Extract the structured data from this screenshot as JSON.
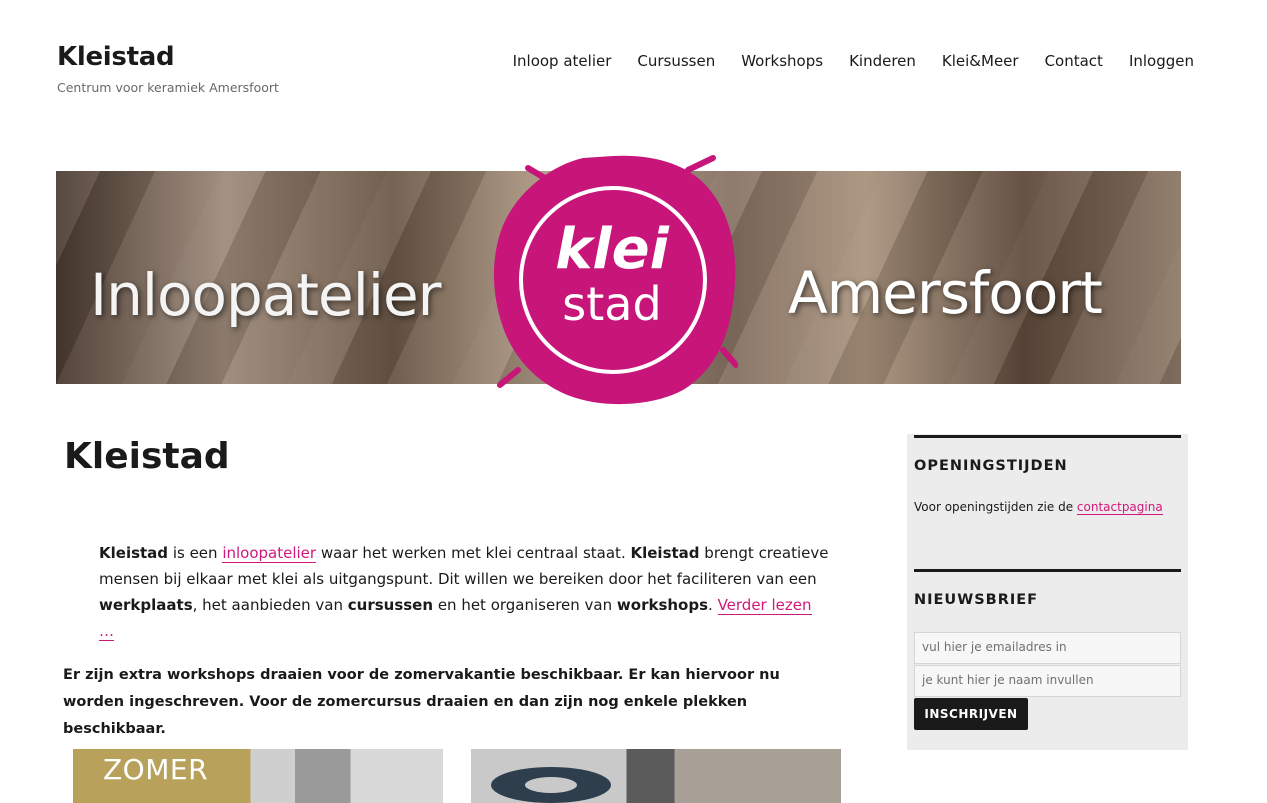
{
  "header": {
    "site_title": "Kleistad",
    "site_description": "Centrum voor keramiek Amersfoort"
  },
  "nav": {
    "items": [
      {
        "label": "Inloop atelier"
      },
      {
        "label": "Cursussen"
      },
      {
        "label": "Workshops"
      },
      {
        "label": "Kinderen"
      },
      {
        "label": "Klei&Meer"
      },
      {
        "label": "Contact"
      },
      {
        "label": "Inloggen"
      }
    ]
  },
  "banner": {
    "left_text": "Inloopatelier",
    "right_text": "Amersfoort",
    "logo_line1": "klei",
    "logo_line2": "stad",
    "logo_color": "#c8157a"
  },
  "main": {
    "page_title": "Kleistad",
    "intro": {
      "b1": "Kleistad",
      "t1": " is een ",
      "link1": "inloopatelier",
      "t2": " waar het werken met klei centraal staat. ",
      "b2": "Kleistad",
      "t3": " brengt creatieve mensen bij elkaar met klei als uitgangspunt. Dit willen we bereiken door het faciliteren van een ",
      "b3": "werkplaats",
      "t4": ", het aanbieden van ",
      "b4": "cursussen",
      "t5": " en het organiseren van ",
      "b5": "workshops",
      "t6": ". ",
      "read_more": "Verder lezen …"
    },
    "notice": "Er zijn extra workshops draaien voor de zomervakantie beschikbaar. Er kan hiervoor nu worden ingeschreven. Voor de zomercursus draaien en dan zijn nog enkele plekken beschikbaar.",
    "thumb1_label": "ZOMER"
  },
  "sidebar": {
    "opening": {
      "title": "OPENINGSTIJDEN",
      "text": "Voor openingstijden zie de ",
      "link": "contactpagina"
    },
    "newsletter": {
      "title": "NIEUWSBRIEF",
      "email_placeholder": "vul hier je emailadres in",
      "name_placeholder": "je kunt hier je naam invullen",
      "button": "INSCHRIJVEN"
    }
  },
  "colors": {
    "accent": "#d0187a",
    "text": "#1a1a1a",
    "sidebar_bg": "#ececec"
  }
}
